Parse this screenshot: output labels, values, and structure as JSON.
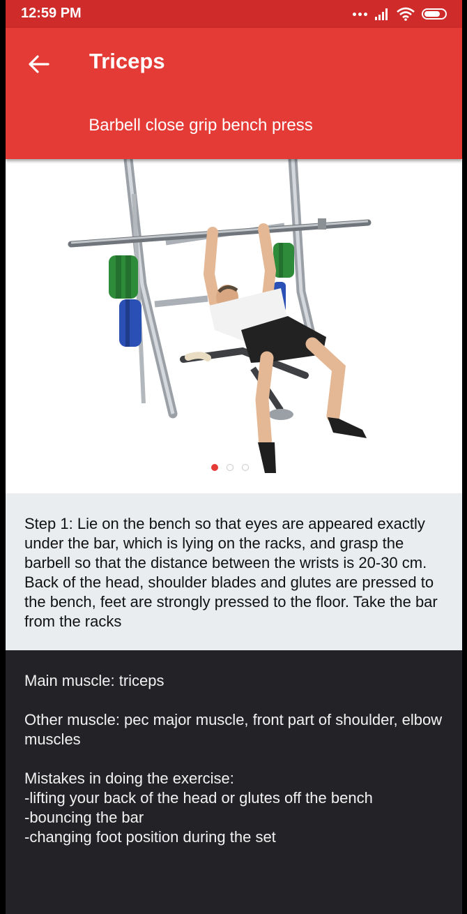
{
  "status_bar": {
    "time": "12:59 PM",
    "icons": [
      "more-dots-icon",
      "signal-icon",
      "wifi-icon",
      "battery-icon"
    ]
  },
  "app_bar": {
    "title": "Triceps",
    "exercise_name": "Barbell close grip bench press",
    "back_icon": "arrow-left-icon"
  },
  "pager": {
    "count": 3,
    "active_index": 0
  },
  "step": {
    "text": "Step 1: Lie on the bench so that eyes are appeared exactly under the bar, which is lying on the racks, and grasp the barbell so that the distance between the wrists is 20-30 cm. Back of the head, shoulder blades and glutes are pressed to the bench, feet are strongly pressed to the floor. Take the bar from the racks"
  },
  "info": {
    "main_muscle": "Main muscle: triceps",
    "other_muscle": "Other muscle: pec major muscle, front part of shoulder, elbow muscles",
    "mistakes_title": "Mistakes in doing the exercise:",
    "mistakes": [
      "-lifting your back of the head or glutes off the bench",
      "-bouncing the bar",
      "-changing foot position during the set"
    ]
  },
  "colors": {
    "app_bar": "#e53b36",
    "status_bar": "#cf2b2b",
    "step_card": "#e9edf0",
    "info_background": "#232226"
  }
}
